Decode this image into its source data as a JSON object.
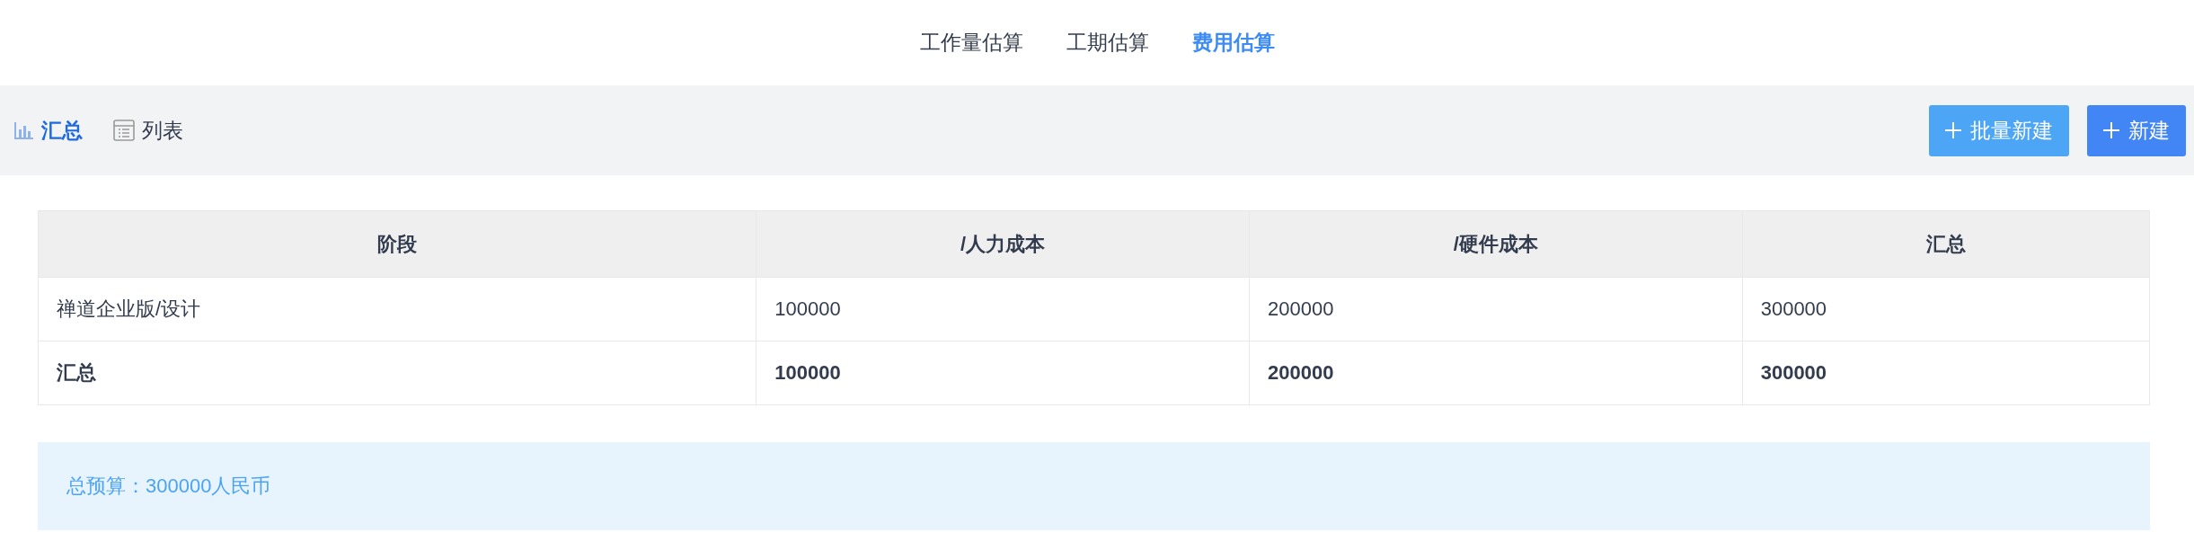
{
  "tabs": [
    {
      "label": "工作量估算",
      "selected": false
    },
    {
      "label": "工期估算",
      "selected": false
    },
    {
      "label": "费用估算",
      "selected": true
    }
  ],
  "views": [
    {
      "label": "汇总",
      "kind": "chart",
      "selected": true
    },
    {
      "label": "列表",
      "kind": "list",
      "selected": false
    }
  ],
  "buttons": [
    {
      "label": "批量新建",
      "kind": "secondary"
    },
    {
      "label": "新建",
      "kind": "primary"
    }
  ],
  "table": {
    "columns": [
      "阶段",
      "/人力成本",
      "/硬件成本",
      "汇总"
    ],
    "rows": [
      {
        "cells": [
          "禅道企业版/设计",
          "100000",
          "200000",
          "300000"
        ],
        "total": false
      },
      {
        "cells": [
          "汇总",
          "100000",
          "200000",
          "300000"
        ],
        "total": true
      }
    ]
  },
  "budget": "总预算：300000人民币"
}
